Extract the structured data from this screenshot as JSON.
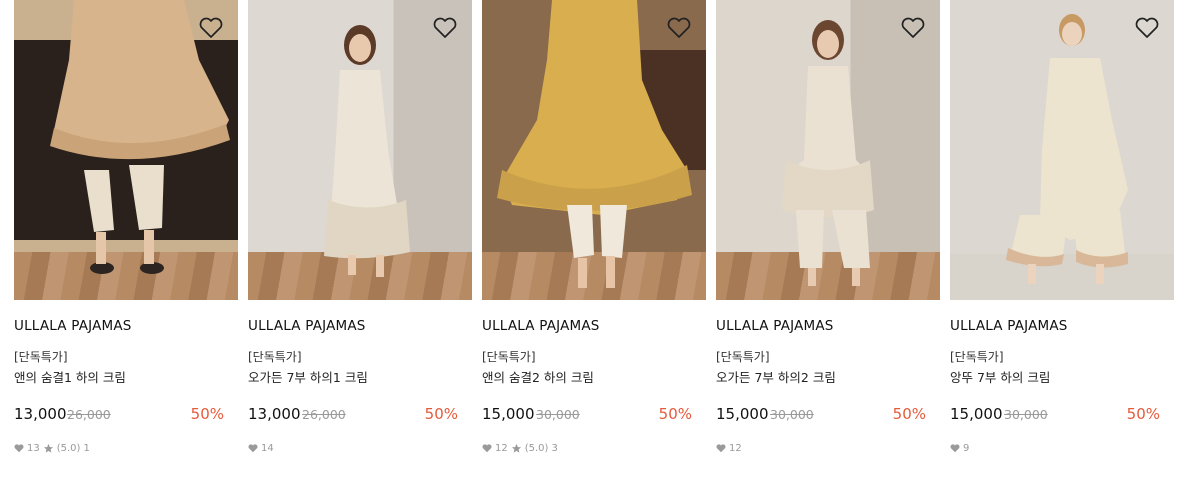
{
  "products": [
    {
      "brand": "ULLALA PAJAMAS",
      "tag": "[단독특가]",
      "name": "앤의 숨결1 하의 크림",
      "price": "13,000",
      "original_price": "26,000",
      "discount": "50%",
      "likes": "13",
      "rating": "(5.0)",
      "reviews": "1",
      "has_rating": true,
      "dress_color": "#d7b48c",
      "icon": "heart-outline"
    },
    {
      "brand": "ULLALA PAJAMAS",
      "tag": "[단독특가]",
      "name": "오가든 7부 하의1 크림",
      "price": "13,000",
      "original_price": "26,000",
      "discount": "50%",
      "likes": "14",
      "has_rating": false,
      "dress_color": "#ece4d6",
      "icon": "heart-outline"
    },
    {
      "brand": "ULLALA PAJAMAS",
      "tag": "[단독특가]",
      "name": "앤의 숨결2 하의 크림",
      "price": "15,000",
      "original_price": "30,000",
      "discount": "50%",
      "likes": "12",
      "rating": "(5.0)",
      "reviews": "3",
      "has_rating": true,
      "dress_color": "#d9ae4e",
      "icon": "heart-outline"
    },
    {
      "brand": "ULLALA PAJAMAS",
      "tag": "[단독특가]",
      "name": "오가든 7부 하의2 크림",
      "price": "15,000",
      "original_price": "30,000",
      "discount": "50%",
      "likes": "12",
      "has_rating": false,
      "dress_color": "#eae1d2",
      "icon": "heart-outline"
    },
    {
      "brand": "ULLALA PAJAMAS",
      "tag": "[단독특가]",
      "name": "앙뚜 7부 하의 크림",
      "price": "15,000",
      "original_price": "30,000",
      "discount": "50%",
      "likes": "9",
      "has_rating": false,
      "dress_color": "#ece4cf",
      "icon": "heart-outline"
    }
  ],
  "colors": {
    "discount": "#e55a3a",
    "muted": "#999999"
  }
}
